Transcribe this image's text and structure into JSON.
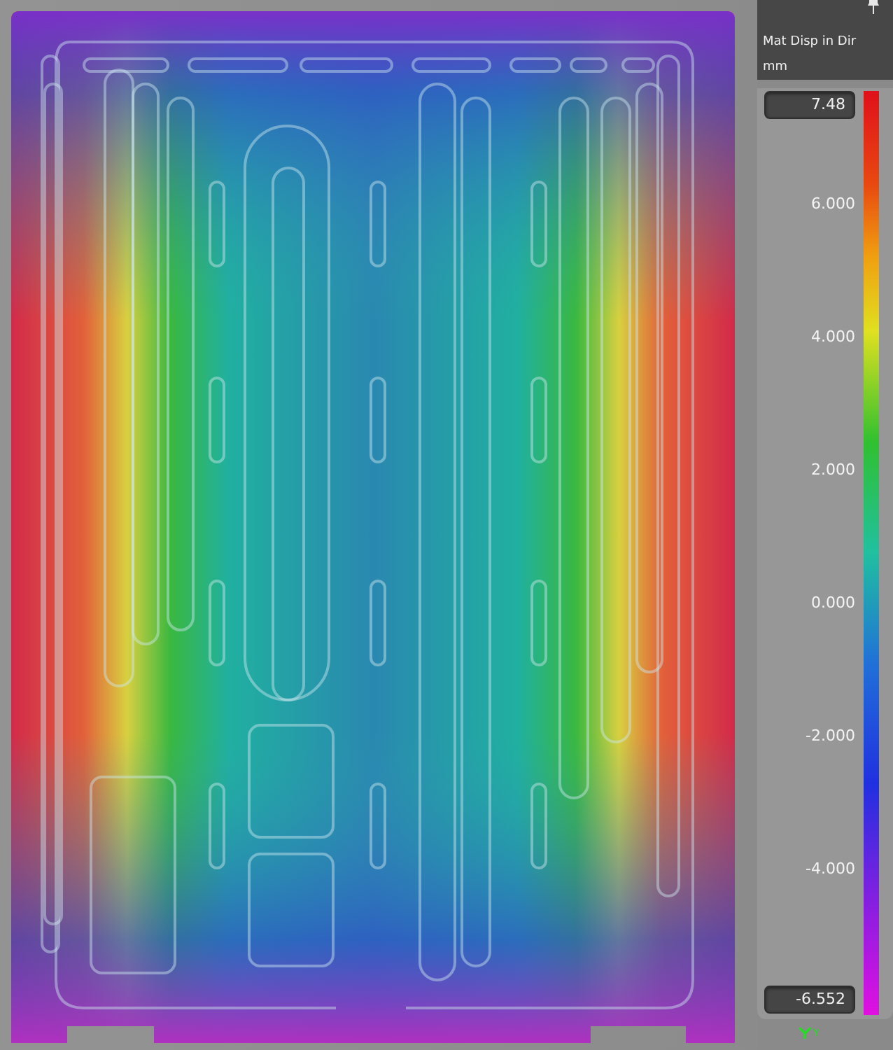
{
  "legend": {
    "title": "Mat Disp in Dir",
    "unit": "mm",
    "max": "7.48",
    "min": "-6.552",
    "labels": [
      "6.000",
      "4.000",
      "2.000",
      "0.000",
      "-2.000",
      "-4.000"
    ]
  },
  "triad": {
    "axis": "Y"
  }
}
